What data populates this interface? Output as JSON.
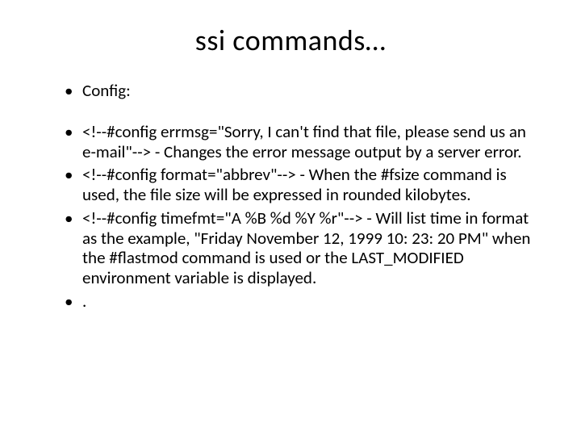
{
  "title": "ssi commands…",
  "bullets": [
    "Config:",
    "",
    "<!--#config errmsg=\"Sorry, I can't find that file, please send us an e-mail\"--> - Changes the error message output by a server error.",
    "<!--#config format=\"abbrev\"--> - When the #fsize command is used, the file size will be expressed in rounded kilobytes.",
    "<!--#config timefmt=\"A %B %d %Y %r\"--> - Will list time in format as the example, \"Friday November 12, 1999 10: 23: 20 PM\" when the #flastmod command is used or the LAST_MODIFIED environment variable is displayed.",
    "."
  ]
}
